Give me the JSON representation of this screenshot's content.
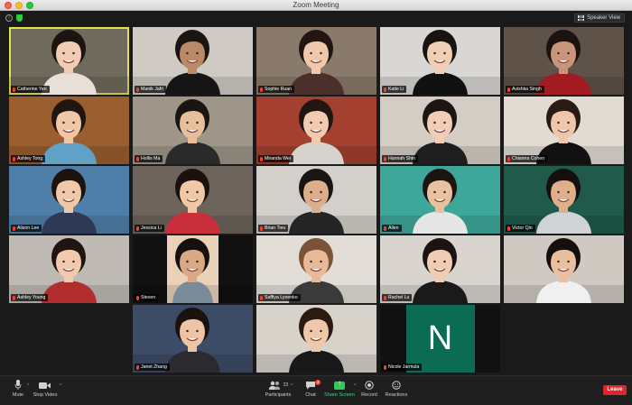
{
  "window": {
    "title": "Zoom Meeting"
  },
  "topbar": {
    "view_label": "Speaker View"
  },
  "participants": [
    {
      "name": "Catherine Yeo",
      "bg": "#6f6a5c",
      "skin": "#f2cdb3",
      "hair": "#1b1410",
      "shirt": "#e8e0d8",
      "active": true
    },
    {
      "name": "Manik Jafri",
      "bg": "#cfcac3",
      "skin": "#b98a68",
      "hair": "#1a1412",
      "shirt": "#151515"
    },
    {
      "name": "Sophie Ruan",
      "bg": "#8a7a6c",
      "skin": "#f0c9ad",
      "hair": "#221612",
      "shirt": "#4a2f2a"
    },
    {
      "name": "Katie Li",
      "bg": "#d9d7d4",
      "skin": "#f1cfb6",
      "hair": "#1a1210",
      "shirt": "#101010"
    },
    {
      "name": "Avishka Singh",
      "bg": "#5e5249",
      "skin": "#c9957a",
      "hair": "#1c1210",
      "shirt": "#a21a22"
    },
    {
      "name": "Ashley Tong",
      "bg": "#9b5e2f",
      "skin": "#f0c7a6",
      "hair": "#211510",
      "shirt": "#5fa2c6"
    },
    {
      "name": "Hollis Ma",
      "bg": "#9d9689",
      "skin": "#e7bf9b",
      "hair": "#1a1512",
      "shirt": "#2a2a2a"
    },
    {
      "name": "Miranda Wei",
      "bg": "#a3402f",
      "skin": "#f1cbb0",
      "hair": "#231612",
      "shirt": "#d6d2cc"
    },
    {
      "name": "Hannah Shin",
      "bg": "#d4cdc3",
      "skin": "#f0cdb4",
      "hair": "#1c1512",
      "shirt": "#1e1e1e"
    },
    {
      "name": "Chianna Cohen",
      "bg": "#e1dbd3",
      "skin": "#eec6aa",
      "hair": "#2a1a14",
      "shirt": "#111111"
    },
    {
      "name": "Alison Lee",
      "bg": "#4f7fa8",
      "skin": "#efc8aa",
      "hair": "#1c130f",
      "shirt": "#2e3a55"
    },
    {
      "name": "Jessica Li",
      "bg": "#6c635a",
      "skin": "#f0c7a7",
      "hair": "#1a110e",
      "shirt": "#c82f3a"
    },
    {
      "name": "Brian Tieu",
      "bg": "#d3d0cb",
      "skin": "#dcae8c",
      "hair": "#1a1512",
      "shirt": "#252525"
    },
    {
      "name": "Allen",
      "bg": "#3fa79a",
      "skin": "#e9c19f",
      "hair": "#1b1411",
      "shirt": "#e6e6e6"
    },
    {
      "name": "Victor Qin",
      "bg": "#1f5a4a",
      "skin": "#dfae8a",
      "hair": "#14100e",
      "shirt": "#cfd3d6"
    },
    {
      "name": "Ashley Young",
      "bg": "#bfbab4",
      "skin": "#f1caad",
      "hair": "#201410",
      "shirt": "#b22e2e"
    },
    {
      "name": "Steven",
      "bg": "#e9d2b8",
      "skin": "#d9a986",
      "hair": "#16110f",
      "shirt": "#7a8a98",
      "letterbox": true
    },
    {
      "name": "Saffiya Lyoenko",
      "bg": "#e2ddd6",
      "skin": "#e6b997",
      "hair": "#7b5236",
      "shirt": "#3a3a3a"
    },
    {
      "name": "Rachel Lu",
      "bg": "#d9d4ce",
      "skin": "#f0ccb2",
      "hair": "#1b1311",
      "shirt": "#1a1a1a"
    },
    {
      "name": "",
      "bg": "#cfc9c2",
      "skin": "#e9bf9e",
      "hair": "#15100e",
      "shirt": "#f0f0f0"
    },
    {
      "name": "Janet Zhang",
      "bg": "#3d4c66",
      "skin": "#edc4a6",
      "hair": "#1a120f",
      "shirt": "#2a2a30"
    },
    {
      "name": "",
      "bg": "#d7d2ca",
      "skin": "#eec8aa",
      "hair": "#2a1a12",
      "shirt": "#181818"
    },
    {
      "name": "Nicole Jarmula",
      "bg": "#111111",
      "letter": "N"
    }
  ],
  "toolbar": {
    "mute": "Mute",
    "video": "Stop Video",
    "participants": "Participants",
    "participants_count": "23",
    "chat": "Chat",
    "chat_badge": "3",
    "share": "Share Screen",
    "record": "Record",
    "reactions": "Reactions",
    "leave": "Leave"
  },
  "colors": {
    "active_outline": "#e6e04a",
    "share_green": "#34c759",
    "leave_red": "#e0262b"
  }
}
